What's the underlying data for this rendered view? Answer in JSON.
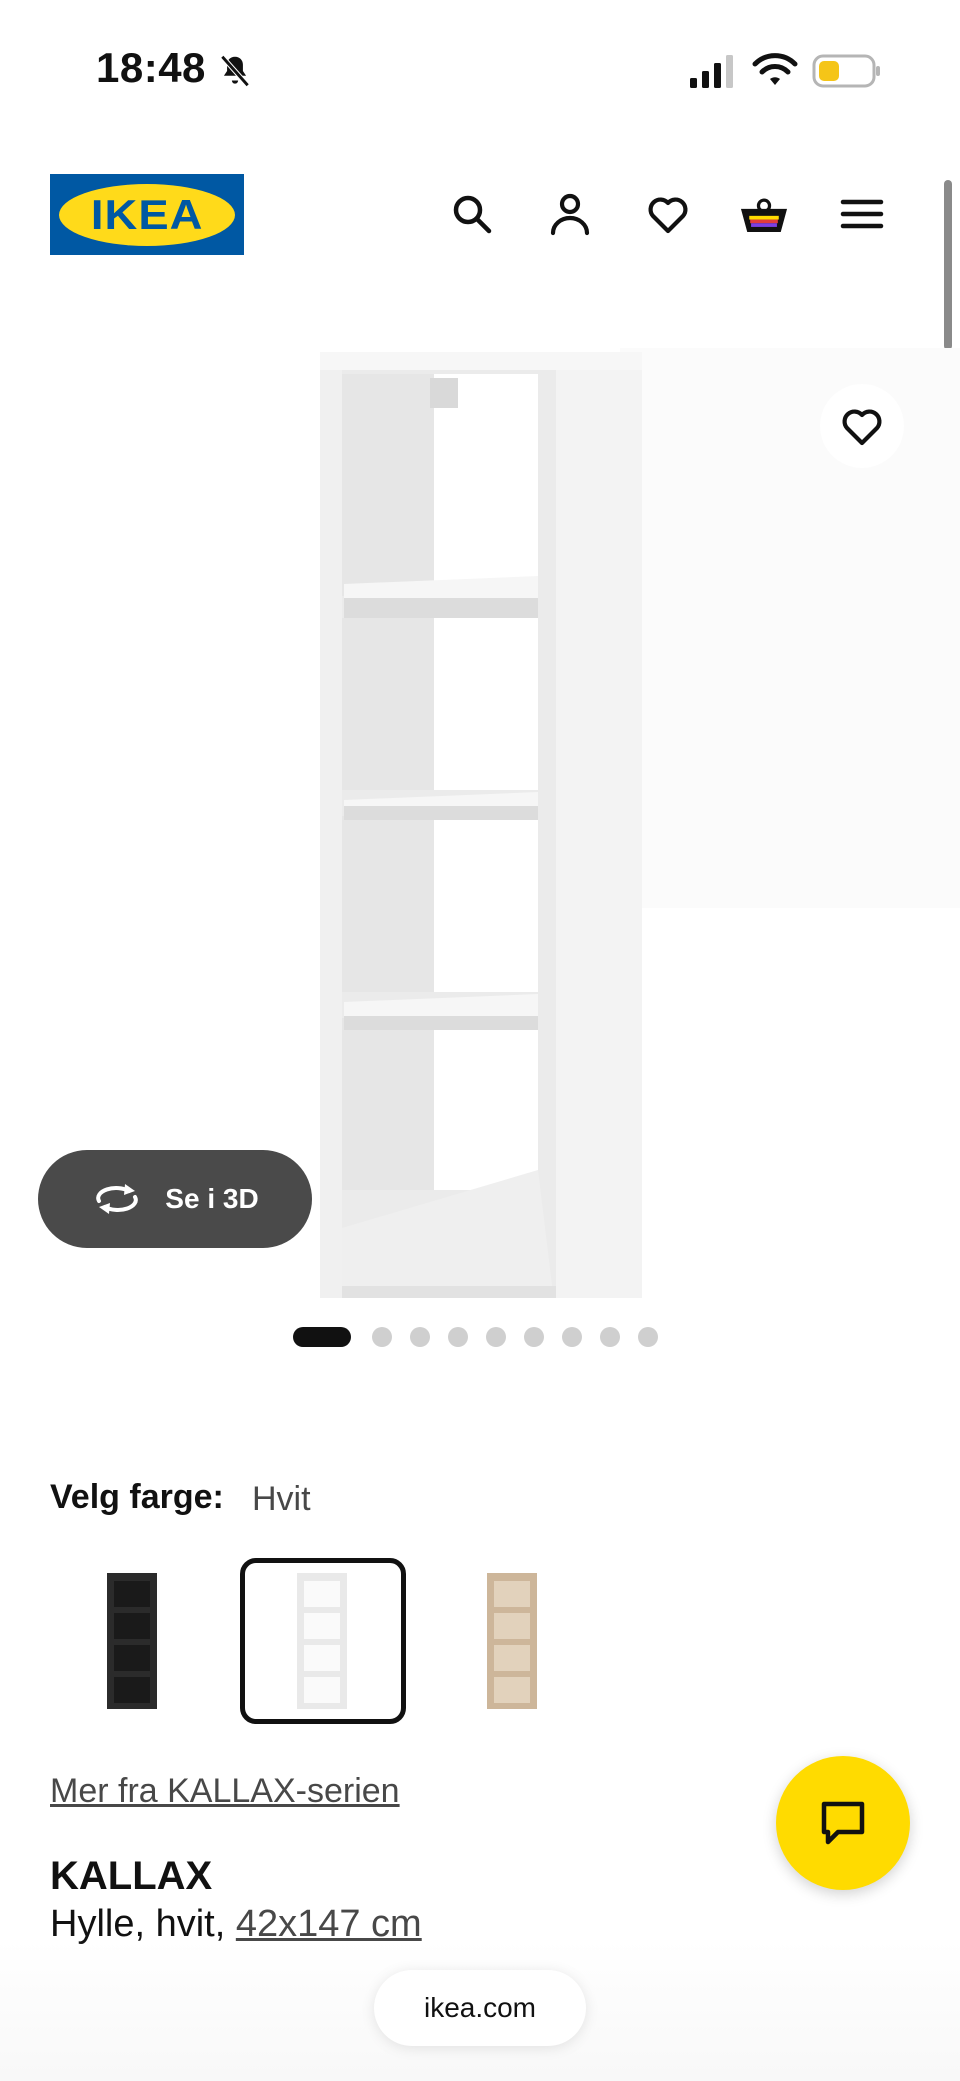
{
  "status_bar": {
    "time": "18:48",
    "icons": [
      "bell-slash-icon",
      "cellular-signal-icon",
      "wifi-icon",
      "battery-icon"
    ],
    "battery_color": "#f5c518"
  },
  "header": {
    "logo_text": "IKEA",
    "logo_colors": {
      "background": "#0058a3",
      "oval": "#ffda1a"
    },
    "icons": [
      "search-icon",
      "profile-icon",
      "heart-icon",
      "basket-icon",
      "menu-icon"
    ]
  },
  "product_gallery": {
    "see_3d_label": "Se i 3D",
    "image_count": 9,
    "active_index": 1
  },
  "color_selector": {
    "label": "Velg farge:",
    "selected_value": "Hvit",
    "options": [
      {
        "name": "Svart",
        "color": "#2b2b2b",
        "selected": false
      },
      {
        "name": "Hvit",
        "color": "#f2f2f2",
        "selected": true
      },
      {
        "name": "Eik",
        "color": "#d6c1a3",
        "selected": false
      }
    ]
  },
  "series_link": "Mer fra KALLAX-serien",
  "product": {
    "name": "KALLAX",
    "description_prefix": "Hylle, hvit, ",
    "size": "42x147 cm"
  },
  "browser": {
    "url": "ikea.com"
  },
  "colors": {
    "accent_yellow": "#ffdb00",
    "dark_button": "#4a4a4a"
  }
}
